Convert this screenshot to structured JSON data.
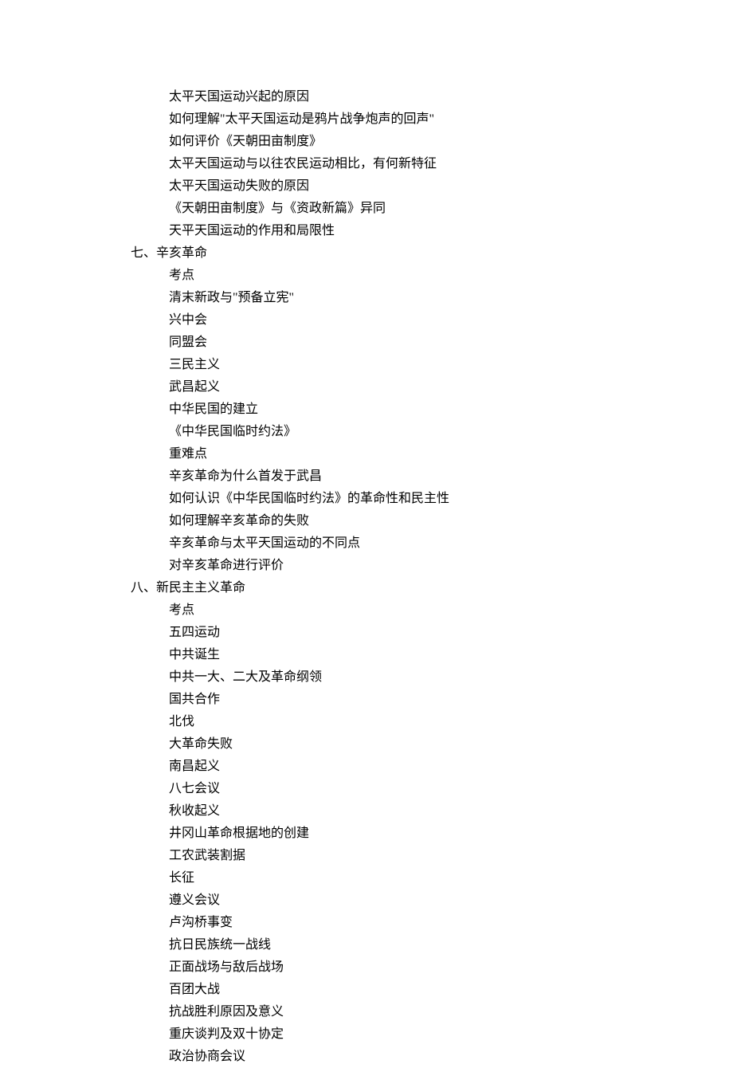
{
  "pre_section_lines": [
    "太平天国运动兴起的原因",
    "如何理解\"太平天国运动是鸦片战争炮声的回声\"",
    "如何评价《天朝田亩制度》",
    "太平天国运动与以往农民运动相比，有何新特征",
    "太平天国运动失败的原因",
    "《天朝田亩制度》与《资政新篇》异同",
    "天平天国运动的作用和局限性"
  ],
  "sections": [
    {
      "title": "七、辛亥革命",
      "lines": [
        "考点",
        "清末新政与\"预备立宪\"",
        "兴中会",
        "同盟会",
        "三民主义",
        "武昌起义",
        "中华民国的建立",
        "《中华民国临时约法》",
        "重难点",
        "辛亥革命为什么首发于武昌",
        "如何认识《中华民国临时约法》的革命性和民主性",
        "如何理解辛亥革命的失败",
        "辛亥革命与太平天国运动的不同点",
        "对辛亥革命进行评价"
      ]
    },
    {
      "title": "八、新民主主义革命",
      "lines": [
        "考点",
        "五四运动",
        "中共诞生",
        "中共一大、二大及革命纲领",
        "国共合作",
        "北伐",
        "大革命失败",
        "南昌起义",
        "八七会议",
        "秋收起义",
        "井冈山革命根据地的创建",
        "工农武装割据",
        "长征",
        "遵义会议",
        "卢沟桥事变",
        "抗日民族统一战线",
        "正面战场与敌后战场",
        "百团大战",
        "抗战胜利原因及意义",
        "重庆谈判及双十协定",
        "政治协商会议"
      ]
    }
  ]
}
